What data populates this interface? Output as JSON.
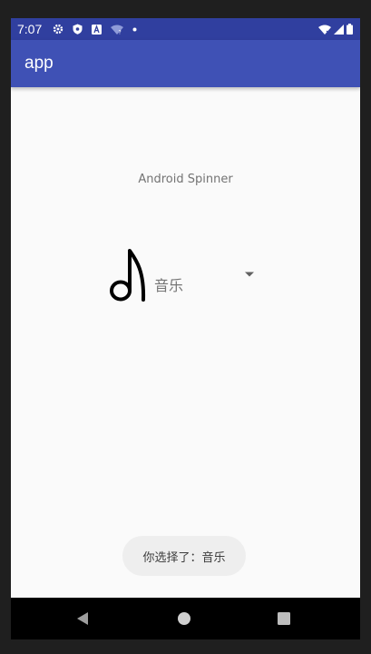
{
  "status_bar": {
    "time": "7:07",
    "left_icons": [
      "settings-icon",
      "shield-icon",
      "a-badge-icon",
      "wifi-question-icon",
      "notification-dot-icon"
    ],
    "right_icons": [
      "wifi-icon",
      "cellular-signal-icon",
      "battery-icon"
    ]
  },
  "app_bar": {
    "title": "app"
  },
  "main": {
    "label": "Android Spinner",
    "spinner": {
      "icon": "music-note-icon",
      "selected_text": "音乐",
      "arrow": "dropdown-arrow-icon"
    }
  },
  "toast": {
    "message": "你选择了：音乐"
  },
  "nav_bar": {
    "buttons": [
      "back-icon",
      "home-icon",
      "recents-icon"
    ]
  },
  "colors": {
    "status_bar": "#303f9f",
    "app_bar": "#3f51b5",
    "background": "#fafafa",
    "toast_background": "#eeeeee"
  }
}
